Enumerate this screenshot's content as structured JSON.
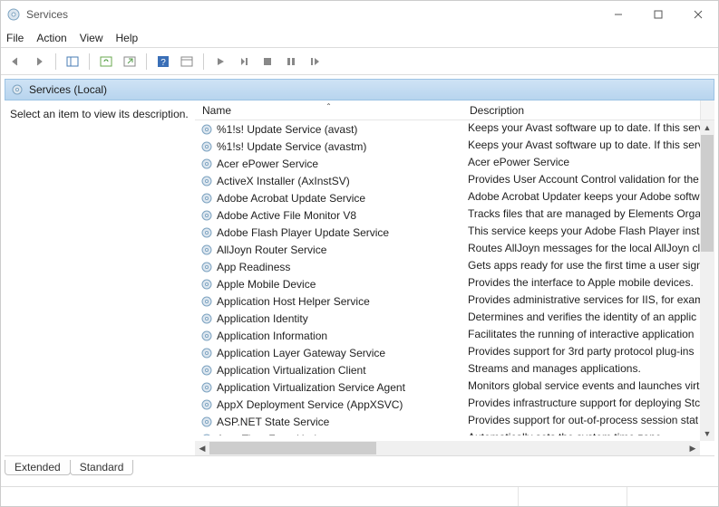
{
  "window": {
    "title": "Services"
  },
  "menu": {
    "file": "File",
    "action": "Action",
    "view": "View",
    "help": "Help"
  },
  "headerBand": "Services (Local)",
  "leftPrompt": "Select an item to view its description.",
  "columns": {
    "name": "Name",
    "description": "Description"
  },
  "tabs": {
    "extended": "Extended",
    "standard": "Standard"
  },
  "services": [
    {
      "name": "%1!s! Update Service (avast)",
      "desc": "Keeps your Avast software up to date. If this serv"
    },
    {
      "name": "%1!s! Update Service (avastm)",
      "desc": "Keeps your Avast software up to date. If this serv"
    },
    {
      "name": "Acer ePower Service",
      "desc": "Acer ePower Service"
    },
    {
      "name": "ActiveX Installer (AxInstSV)",
      "desc": "Provides User Account Control validation for the"
    },
    {
      "name": "Adobe Acrobat Update Service",
      "desc": "Adobe Acrobat Updater keeps your Adobe softw"
    },
    {
      "name": "Adobe Active File Monitor V8",
      "desc": "Tracks files that are managed by Elements Orgar"
    },
    {
      "name": "Adobe Flash Player Update Service",
      "desc": "This service keeps your Adobe Flash Player insta"
    },
    {
      "name": "AllJoyn Router Service",
      "desc": "Routes AllJoyn messages for the local AllJoyn cli"
    },
    {
      "name": "App Readiness",
      "desc": "Gets apps ready for use the first time a user sign"
    },
    {
      "name": "Apple Mobile Device",
      "desc": "Provides the interface to Apple mobile devices."
    },
    {
      "name": "Application Host Helper Service",
      "desc": "Provides administrative services for IIS, for exam"
    },
    {
      "name": "Application Identity",
      "desc": "Determines and verifies the identity of an applic"
    },
    {
      "name": "Application Information",
      "desc": "Facilitates the running of interactive application"
    },
    {
      "name": "Application Layer Gateway Service",
      "desc": "Provides support for 3rd party protocol plug-ins"
    },
    {
      "name": "Application Virtualization Client",
      "desc": "Streams and manages applications."
    },
    {
      "name": "Application Virtualization Service Agent",
      "desc": "Monitors global service events and launches virt"
    },
    {
      "name": "AppX Deployment Service (AppXSVC)",
      "desc": "Provides infrastructure support for deploying Stc"
    },
    {
      "name": "ASP.NET State Service",
      "desc": "Provides support for out-of-process session stat"
    },
    {
      "name": "Auto Time Zone Updater",
      "desc": "Automatically sets the system time zone."
    }
  ]
}
